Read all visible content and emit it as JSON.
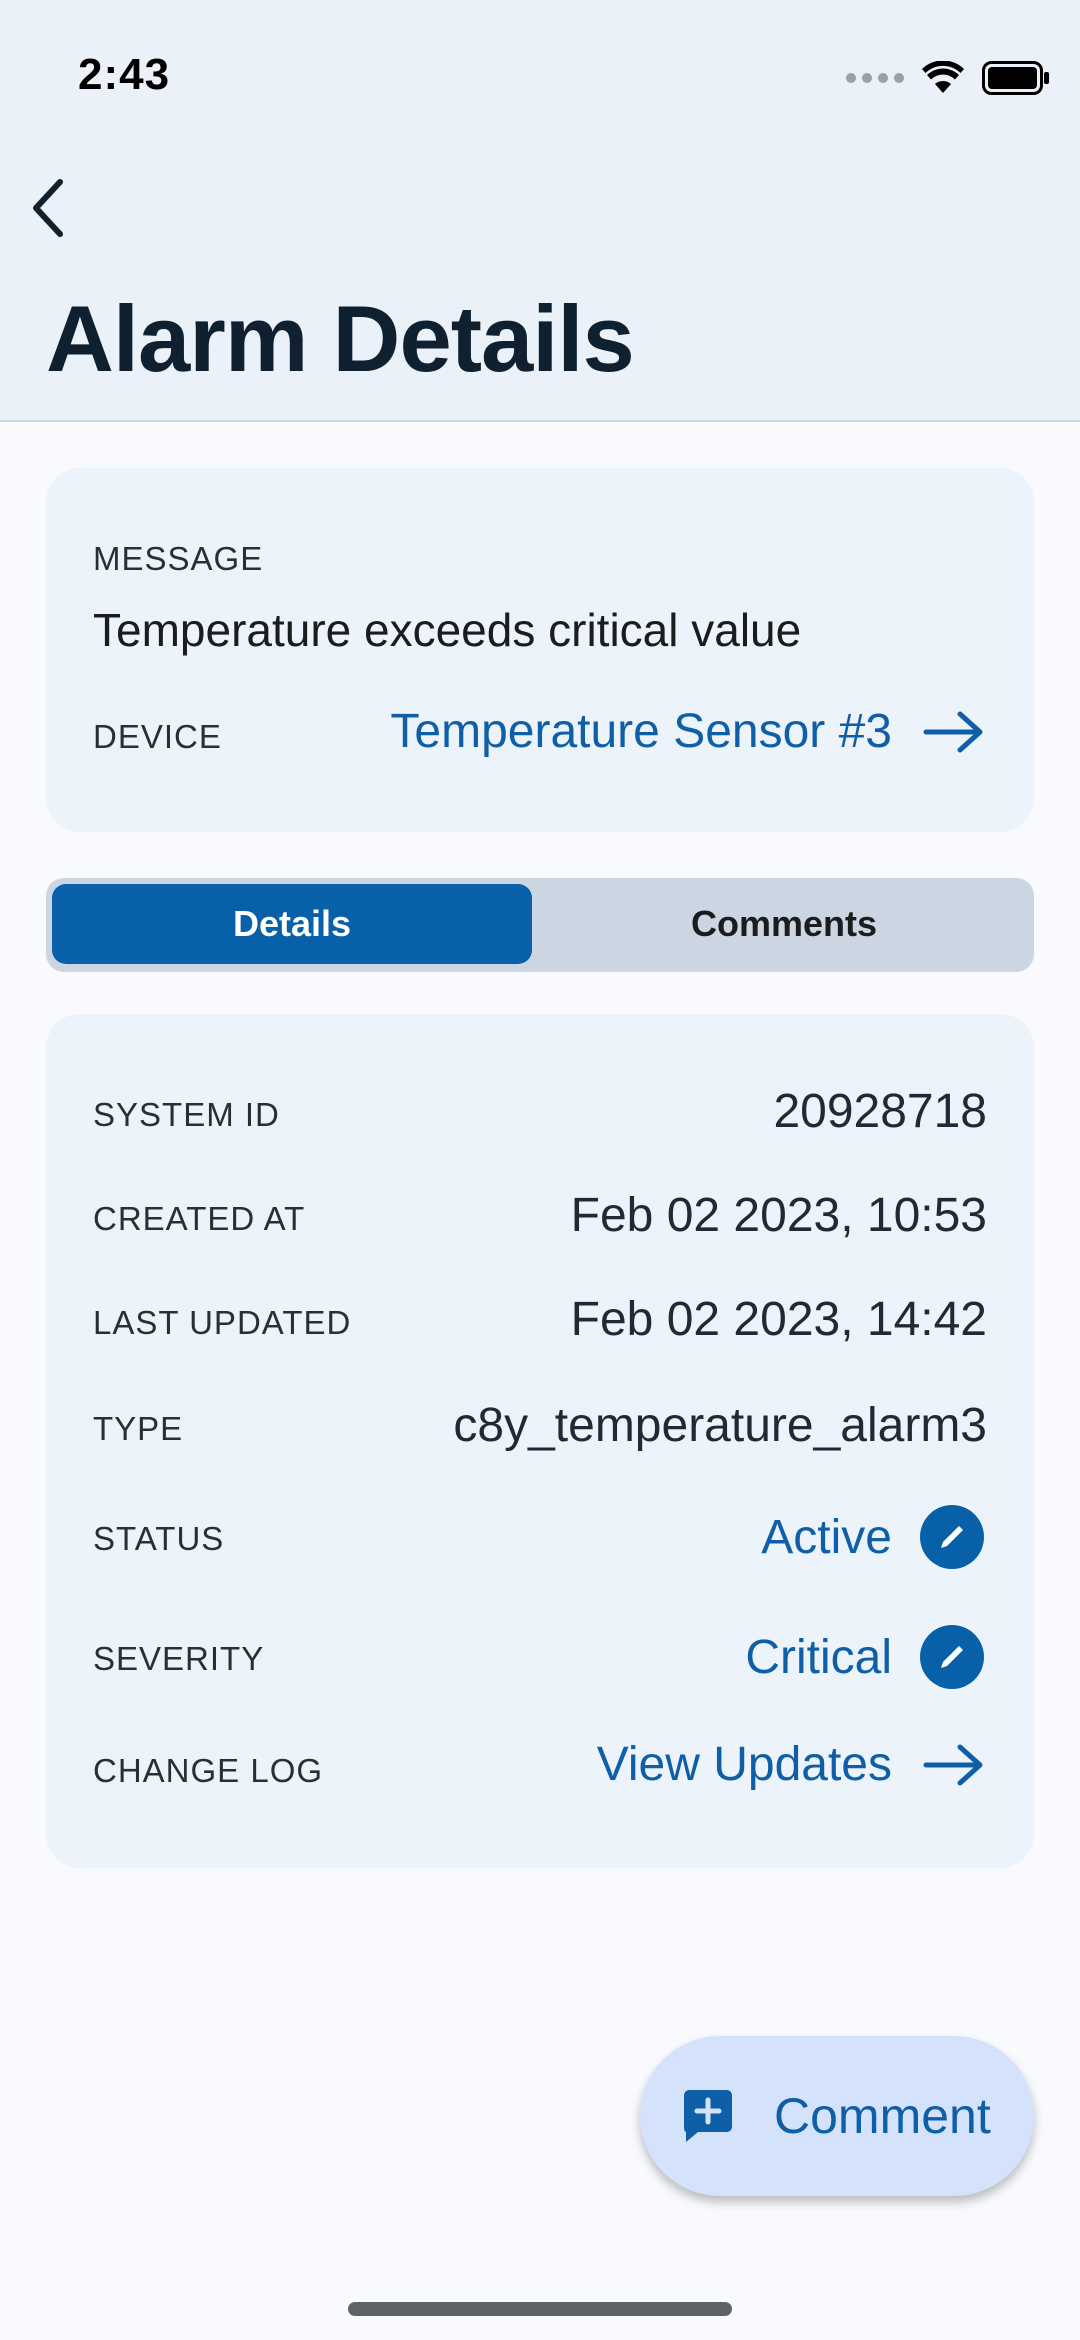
{
  "status_bar": {
    "time": "2:43"
  },
  "header": {
    "title": "Alarm Details"
  },
  "summary": {
    "message_label": "MESSAGE",
    "message": "Temperature exceeds critical value",
    "device_label": "DEVICE",
    "device": "Temperature Sensor #3"
  },
  "tabs": {
    "details": "Details",
    "comments": "Comments",
    "selected": "Details"
  },
  "details": {
    "system_id_label": "SYSTEM ID",
    "system_id": "20928718",
    "created_label": "CREATED AT",
    "created": "Feb 02 2023, 10:53",
    "updated_label": "LAST UPDATED",
    "updated": "Feb 02 2023, 14:42",
    "type_label": "TYPE",
    "type": "c8y_temperature_alarm3",
    "status_label": "STATUS",
    "status": "Active",
    "severity_label": "SEVERITY",
    "severity": "Critical",
    "changelog_label": "CHANGE LOG",
    "changelog": "View Updates"
  },
  "fab": {
    "label": "Comment",
    "icon": "comment-add-icon"
  },
  "colors": {
    "accent": "#0860a8",
    "link": "#0f5fa8",
    "header_bg": "#ebf1f8",
    "card_bg": "#edf3fa"
  }
}
